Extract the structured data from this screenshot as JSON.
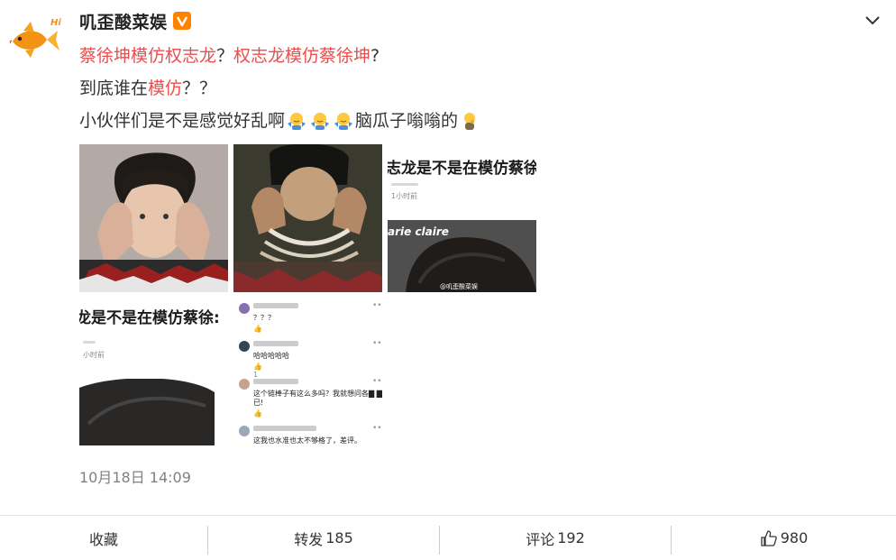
{
  "post": {
    "author": "叽歪酸菜娱",
    "verified_badge": "V",
    "avatar_icon": "goldfish-icon",
    "avatar_text": "Hi",
    "line1": {
      "a": "蔡徐坤模仿权志龙",
      "b": "？",
      "c": "权志龙模仿蔡徐坤",
      "d": "?"
    },
    "line2": {
      "a": "到底谁在",
      "b": "模仿",
      "c": "？？"
    },
    "line3": {
      "a": "小伙伴们是不是感觉好乱啊",
      "b": "脑瓜子嗡嗡的"
    },
    "timestamp": "10月18日 14:09"
  },
  "images": {
    "t3_headline": "志龙是不是在模仿蔡徐坤",
    "t3_time": "1小时前",
    "t3_magazine": "arie claire",
    "t3_watermark": "@叽歪酸菜娱",
    "t4_headline": "龙是不是在模仿蔡徐:",
    "t4_time": "小时前",
    "comments": [
      {
        "text": "？？？",
        "likes": ""
      },
      {
        "text": "哈哈哈哈哈",
        "likes": "1"
      },
      {
        "text": "这个链棒子有这么多吗？我就想问各▇ ▇而",
        "text2": "已!",
        "likes": ""
      },
      {
        "text": "这我也水准也太不够格了，差评。",
        "likes": ""
      }
    ]
  },
  "actions": {
    "favorite": "收藏",
    "repost_label": "转发",
    "repost_count": "185",
    "comment_label": "评论",
    "comment_count": "192",
    "like_count": "980"
  },
  "colors": {
    "highlight": "#eb4e4e",
    "badge": "#ff8200",
    "muted": "#808080"
  }
}
